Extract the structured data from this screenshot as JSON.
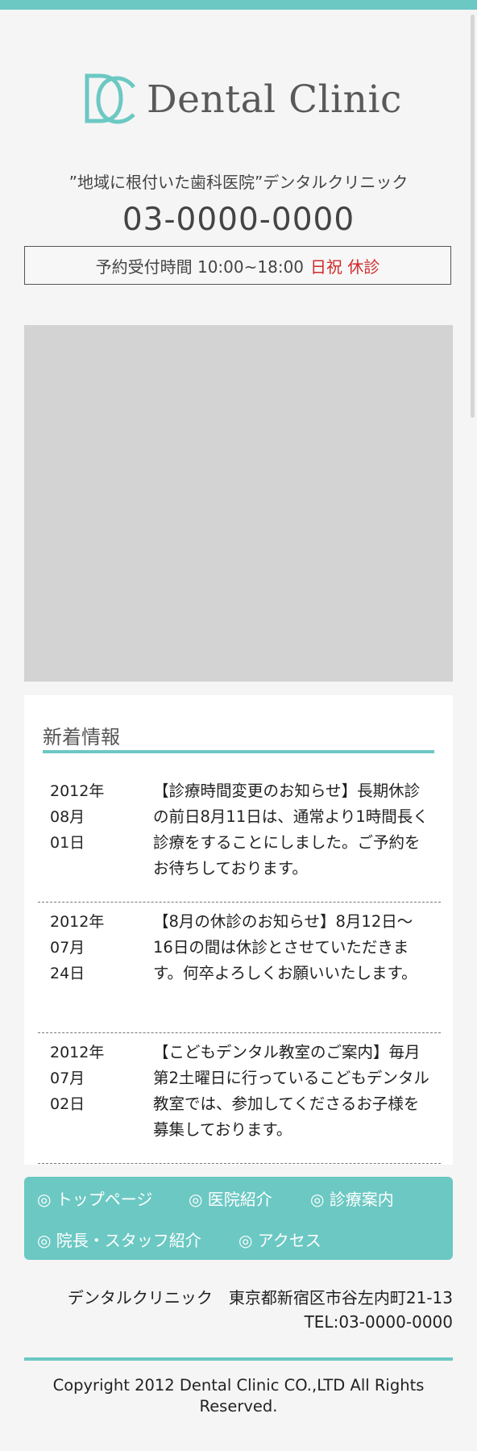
{
  "header": {
    "logo_text": "Dental Clinic",
    "logo_mark": "DC",
    "tagline": "”地域に根付いた歯科医院”デンタルクリニック",
    "phone": "03-0000-0000",
    "hours_label": "予約受付時間 10:00~18:00",
    "hours_closed": "日祝 休診"
  },
  "news": {
    "heading": "新着情報",
    "items": [
      {
        "date": "2012年\n08月\n01日",
        "text": "【診療時間変更のお知らせ】長期休診の前日8月11日は、通常より1時間長く診療をすることにしました。ご予約をお待ちしております。"
      },
      {
        "date": "2012年\n07月\n24日",
        "text": "【8月の休診のお知らせ】8月12日〜16日の間は休診とさせていただきます。何卒よろしくお願いいたします。"
      },
      {
        "date": "2012年\n07月\n02日",
        "text": "【こどもデンタル教室のご案内】毎月第2土曜日に行っているこどもデンタル教室では、参加してくださるお子様を募集しております。"
      }
    ]
  },
  "footer_nav": {
    "items": [
      "◎ トップページ",
      "◎ 医院紹介",
      "◎ 診療案内",
      "◎ 院長・スタッフ紹介",
      "◎ アクセス"
    ]
  },
  "footer": {
    "address": "デンタルクリニック　東京都新宿区市谷左内町21-13",
    "tel": "TEL:03-0000-0000",
    "copyright": "Copyright 2012 Dental Clinic CO.,LTD All Rights Reserved."
  },
  "colors": {
    "accent": "#6cc8c3",
    "closed": "#d12a2a",
    "placeholder": "#d3d3d3"
  }
}
